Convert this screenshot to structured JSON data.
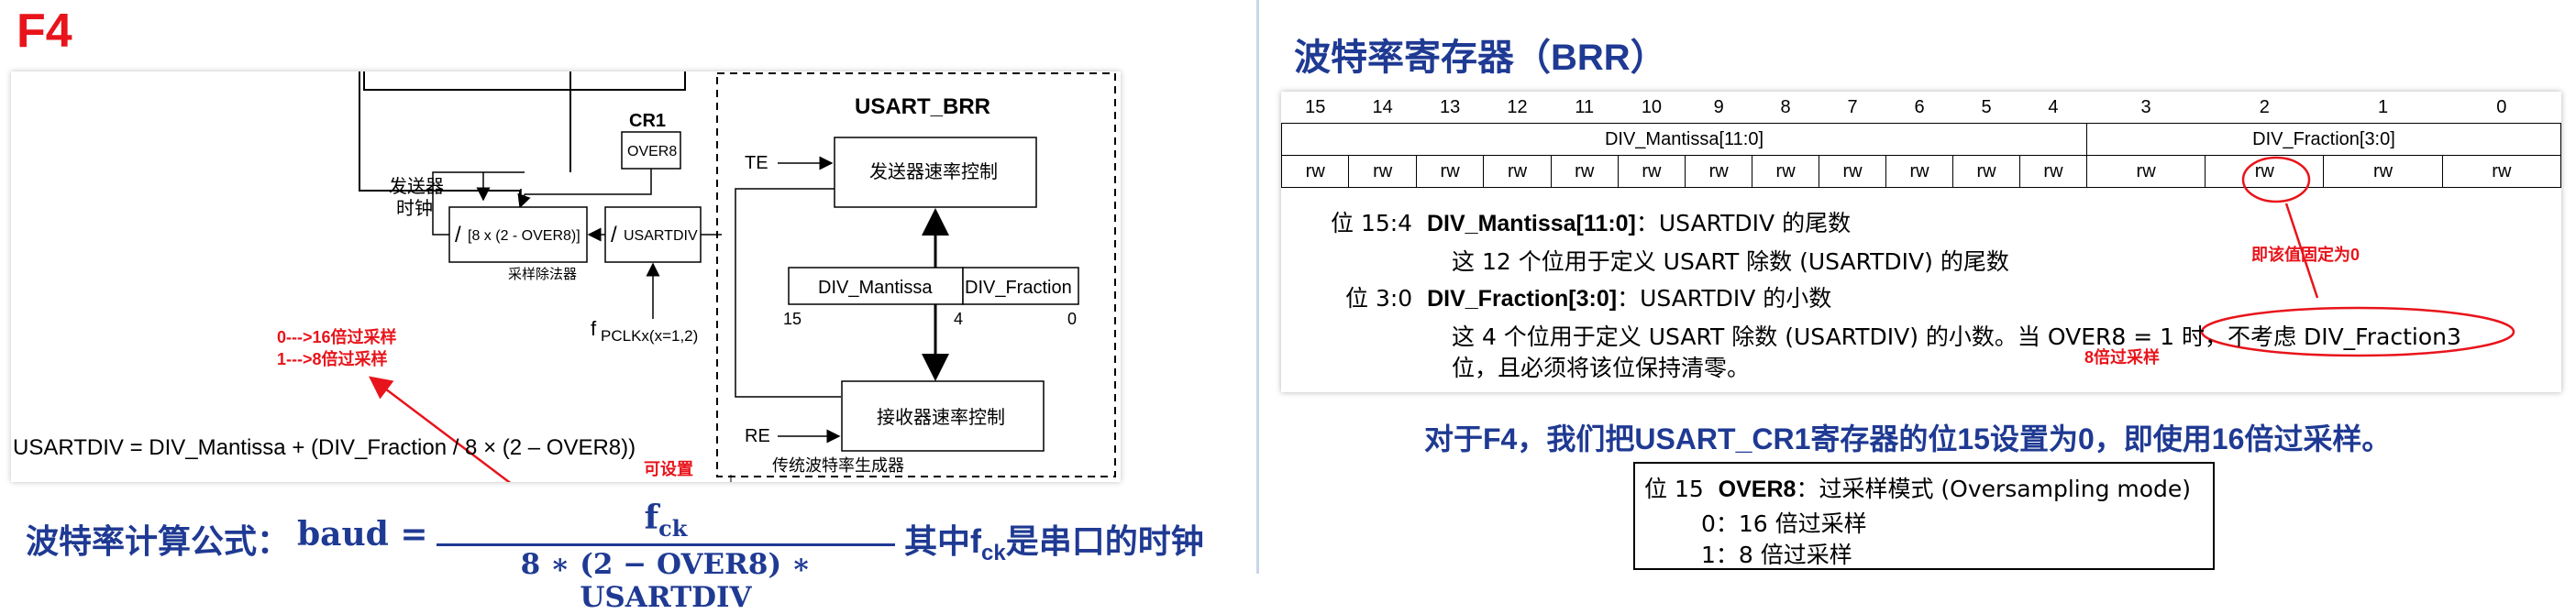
{
  "left": {
    "title": "F4",
    "diagram": {
      "brr_label": "USART_BRR",
      "cr1_label": "CR1",
      "over8_label": "OVER8",
      "tx_clock_label_1": "发送器",
      "tx_clock_label_2": "时钟",
      "divider_formula": "[8 x (2 - OVER8)]",
      "divider_slash": "/",
      "divider_caption": "采样除法器",
      "usartdiv_label": "USARTDIV",
      "usartdiv_slash": "/",
      "pclk_main": "f",
      "pclk_sub": "PCLKx(x=1,2)",
      "te_label": "TE",
      "re_label": "RE",
      "tx_rate_ctrl": "发送器速率控制",
      "rx_rate_ctrl": "接收器速率控制",
      "div_mantissa": "DIV_Mantissa",
      "div_fraction": "DIV_Fraction",
      "bit_15": "15",
      "bit_4": "4",
      "bit_0": "0",
      "legacy_gen": "传统波特率生成器",
      "usartdiv_formula": "USARTDIV = DIV_Mantissa + (DIV_Fraction / 8 × (2 – OVER8))",
      "annot_over_1": "0--->16倍过采样",
      "annot_over_2": "1--->8倍过采样",
      "annot_settable": "可设置"
    },
    "formula": {
      "label": "波特率计算公式：",
      "lhs": "baud =",
      "numerator": "f",
      "numerator_sub": "ck",
      "denominator": "8 ∗ (2 − OVER8) ∗ USARTDIV",
      "tail_prefix": "其中f",
      "tail_sub": "ck",
      "tail_suffix": "是串口的时钟"
    }
  },
  "right": {
    "title": "波特率寄存器（BRR）",
    "bit_numbers": [
      "15",
      "14",
      "13",
      "12",
      "11",
      "10",
      "9",
      "8",
      "7",
      "6",
      "5",
      "4",
      "3",
      "2",
      "1",
      "0"
    ],
    "field_mantissa": "DIV_Mantissa[11:0]",
    "field_fraction": "DIV_Fraction[3:0]",
    "access": [
      "rw",
      "rw",
      "rw",
      "rw",
      "rw",
      "rw",
      "rw",
      "rw",
      "rw",
      "rw",
      "rw",
      "rw",
      "rw",
      "rw",
      "rw",
      "rw"
    ],
    "desc": {
      "m_pos": "位 15:4",
      "m_name": "DIV_Mantissa[11:0]",
      "m_colon": "：USARTDIV 的尾数",
      "m_detail": "这 12 个位用于定义 USART 除数 (USARTDIV) 的尾数",
      "f_pos": "位 3:0",
      "f_name": "DIV_Fraction[3:0]",
      "f_colon": "：USARTDIV 的小数",
      "f_detail_1": "这 4 个位用于定义 USART 除数 (USARTDIV) 的小数。当 OVER8 = 1 时，",
      "f_detail_1b": "不考虑 DIV_Fraction3",
      "f_detail_2": "位，且必须将该位保持清零。"
    },
    "annot_fixed_zero": "即该值固定为0",
    "annot_8x": "8倍过采样",
    "f4_note": "对于F4，我们把USART_CR1寄存器的位15设置为0，即使用16倍过采样。",
    "over8": {
      "pos": "位 15",
      "name": "OVER8",
      "title_rest": "：过采样模式 (Oversampling mode)",
      "opt0": "0：16 倍过采样",
      "opt1": "1：8 倍过采样"
    }
  },
  "colors": {
    "accent_red": "#e8141b",
    "title_blue": "#1f3a93"
  }
}
